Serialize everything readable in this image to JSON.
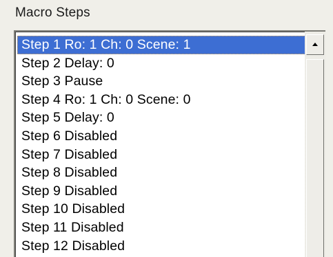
{
  "group_label": "Macro Steps",
  "selected_index": 0,
  "items": [
    {
      "label": "Step  1  Ro: 1 Ch: 0 Scene: 1"
    },
    {
      "label": "Step  2  Delay: 0"
    },
    {
      "label": "Step  3  Pause"
    },
    {
      "label": "Step  4  Ro: 1 Ch: 0 Scene: 0"
    },
    {
      "label": "Step  5  Delay: 0"
    },
    {
      "label": "Step  6 Disabled"
    },
    {
      "label": "Step  7 Disabled"
    },
    {
      "label": "Step  8 Disabled"
    },
    {
      "label": "Step  9 Disabled"
    },
    {
      "label": "Step  10 Disabled"
    },
    {
      "label": "Step  11 Disabled"
    },
    {
      "label": "Step  12 Disabled"
    }
  ],
  "colors": {
    "selection_bg": "#3d6ed3",
    "selection_text": "#ffffff"
  },
  "icons": {
    "scroll_up": "chevron-up-icon"
  }
}
